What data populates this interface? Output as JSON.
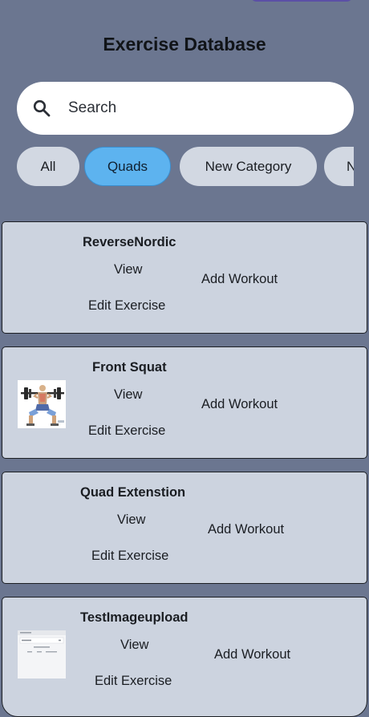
{
  "header": {
    "title": "Exercise Database"
  },
  "search": {
    "placeholder": "Search",
    "icon": "search-icon"
  },
  "categories": [
    {
      "label": "All",
      "selected": false
    },
    {
      "label": "Quads",
      "selected": true
    },
    {
      "label": "New Category",
      "selected": false
    },
    {
      "label": "N",
      "selected": false
    }
  ],
  "exercises": [
    {
      "name": "ReverseNordic",
      "view_label": "View",
      "edit_label": "Edit Exercise",
      "add_label": "Add Workout",
      "has_image": false
    },
    {
      "name": "Front Squat",
      "view_label": "View",
      "edit_label": "Edit Exercise",
      "add_label": "Add Workout",
      "has_image": true
    },
    {
      "name": "Quad Extenstion",
      "view_label": "View",
      "edit_label": "Edit Exercise",
      "add_label": "Add Workout",
      "has_image": false
    },
    {
      "name": "TestImageupload",
      "view_label": "View",
      "edit_label": "Edit Exercise",
      "add_label": "Add Workout",
      "has_image": true
    }
  ],
  "colors": {
    "background": "#6b7690",
    "card": "#ccd3df",
    "chip": "#d2d8e2",
    "chip_active": "#5db3ef"
  }
}
